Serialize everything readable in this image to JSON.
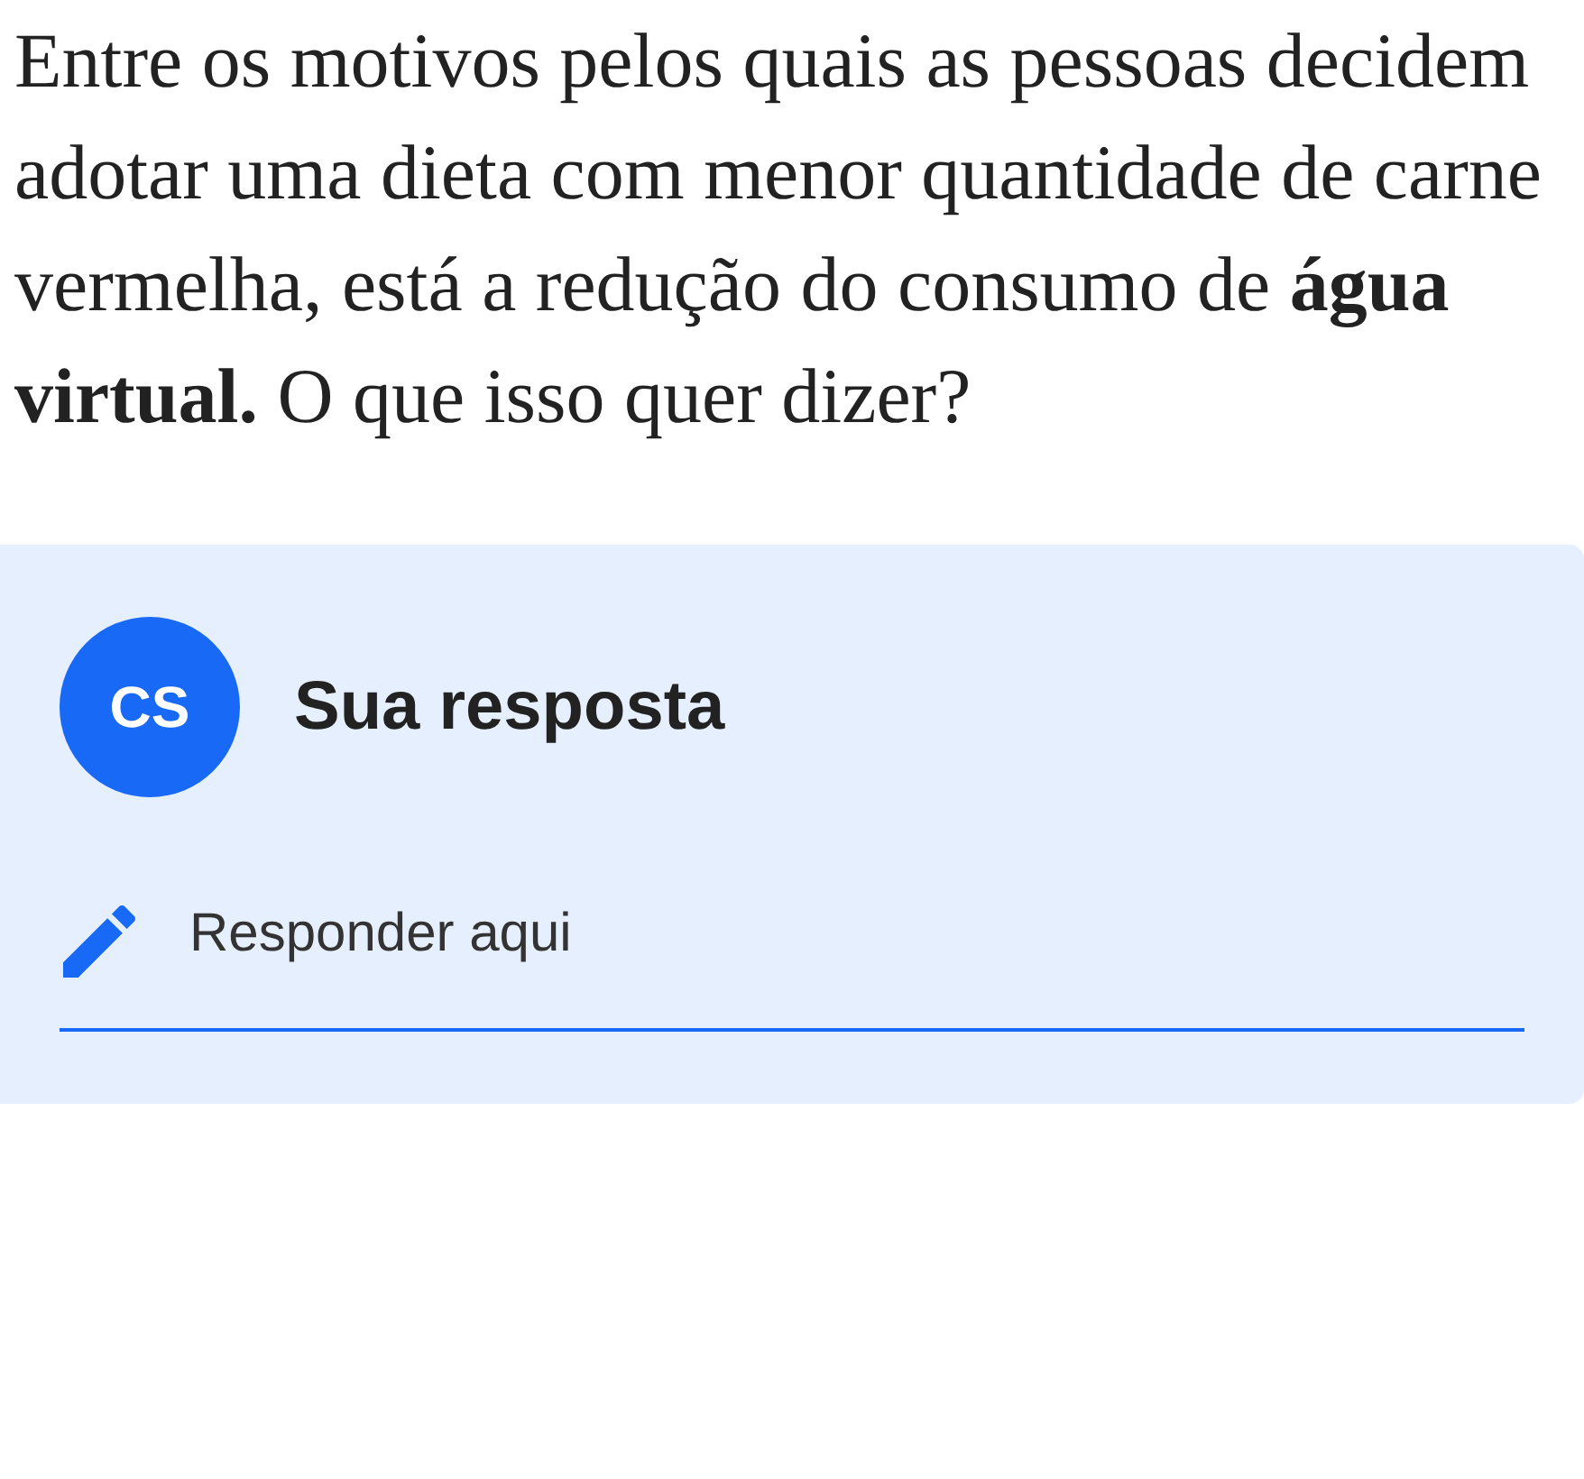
{
  "question": {
    "text": "Entre os motivos pelos quais as pessoas decidem adotar uma dieta com menor quantidade de carne vermelha, está a redução do consumo de **água virtual.** O que isso quer dizer?"
  },
  "answer": {
    "avatar": "CS",
    "title": "Sua resposta",
    "placeholder": "Responder aqui"
  }
}
